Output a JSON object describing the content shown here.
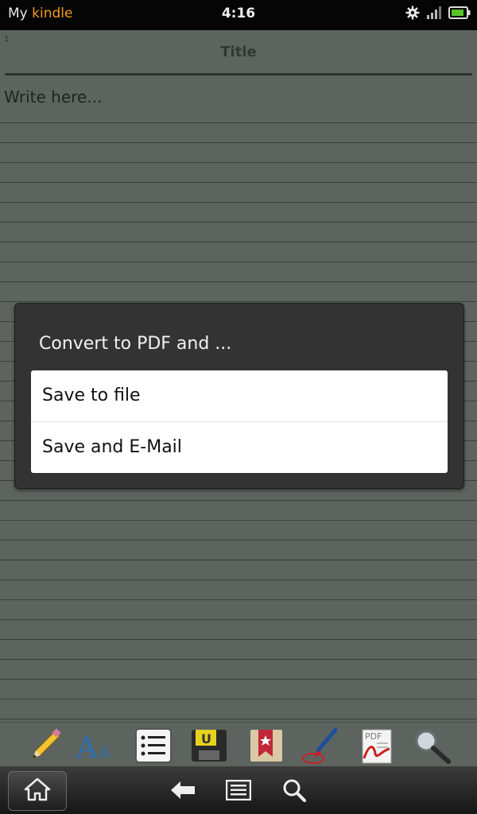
{
  "status_bar": {
    "brand_prefix": "My",
    "brand_name": "kindle",
    "time": "4:16",
    "icons": [
      "gear-icon",
      "signal-icon",
      "battery-icon"
    ]
  },
  "document": {
    "page_number": "1",
    "title": "Title",
    "body_text": "Write here..."
  },
  "dialog": {
    "title": "Convert to PDF and ...",
    "options": [
      "Save to file",
      "Save and E-Mail"
    ]
  },
  "toolbar": {
    "tools": [
      "pencil-icon",
      "font-icon",
      "list-icon",
      "save-disk-icon",
      "bookmark-icon",
      "brush-icon",
      "pdf-icon",
      "magnifier-icon"
    ]
  },
  "nav_bar": {
    "buttons": [
      "home-icon",
      "back-icon",
      "menu-icon",
      "search-icon"
    ]
  },
  "colors": {
    "brand_accent": "#f39a1a",
    "page_background": "#5d6460",
    "dialog_background": "#333333"
  }
}
